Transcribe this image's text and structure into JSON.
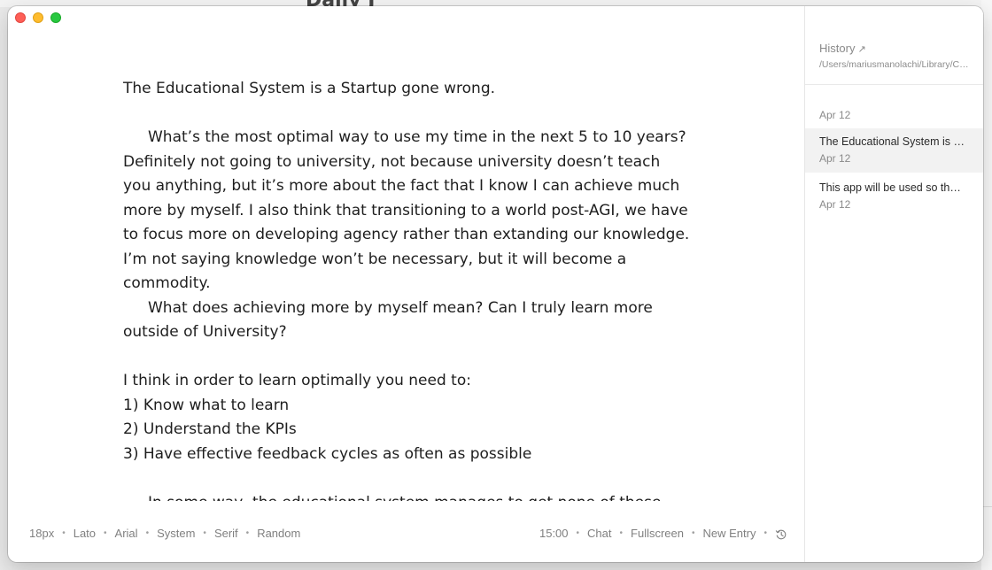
{
  "background": {
    "title_fragment": "Daily J"
  },
  "editor": {
    "paragraphs": [
      {
        "text": "The Educational System is a Startup gone wrong.",
        "indent": false
      },
      {
        "text": "",
        "indent": false
      },
      {
        "text": "What’s the most optimal way to use my time in the next 5 to 10 years? Definitely not going to university, not because university doesn’t teach you anything, but it’s more about the fact that I know I can achieve much more by myself. I also think that transitioning to a world post-AGI, we have to focus more on developing agency rather than extanding our knowledge. I’m not saying knowledge won’t be necessary, but it will become a commodity.",
        "indent": true
      },
      {
        "text": "What does achieving more by myself mean? Can I truly learn more outside of University?",
        "indent": true
      },
      {
        "text": "",
        "indent": false
      },
      {
        "text": "I think in order to learn optimally you need to:",
        "indent": false
      },
      {
        "text": "1) Know what to learn",
        "indent": false
      },
      {
        "text": "2) Understand the KPIs",
        "indent": false
      },
      {
        "text": "3) Have effective feedback cycles as often as possible",
        "indent": false
      },
      {
        "text": "",
        "indent": false
      },
      {
        "text": "In some way, the educational system manages to get none of these right… I mean, someone thought about a model of “what teaching kids should look like”",
        "indent": true
      }
    ]
  },
  "footer": {
    "font_size": "18px",
    "fonts": [
      "Lato",
      "Arial",
      "System",
      "Serif",
      "Random"
    ],
    "timer": "15:00",
    "chat": "Chat",
    "fullscreen": "Fullscreen",
    "new_entry": "New Entry",
    "history_icon": "history-clock-icon"
  },
  "sidebar": {
    "title": "History",
    "title_icon": "arrow-up-right-icon",
    "path": "/Users/mariusmanolachi/Library/Containers/freewrite",
    "entries": [
      {
        "title": "",
        "date": "Apr 12",
        "active": false
      },
      {
        "title": "The Educational System is a Startup gone wrong.",
        "date": "Apr 12",
        "active": true
      },
      {
        "title": "This app will be used so that I can write freely",
        "date": "Apr 12",
        "active": false
      }
    ]
  },
  "colors": {
    "close": "#fe5f57",
    "minimize": "#febc2e",
    "zoom": "#28c840",
    "text": "#1e1e1e",
    "muted": "#808080",
    "active_entry": "#f2f2f2"
  }
}
